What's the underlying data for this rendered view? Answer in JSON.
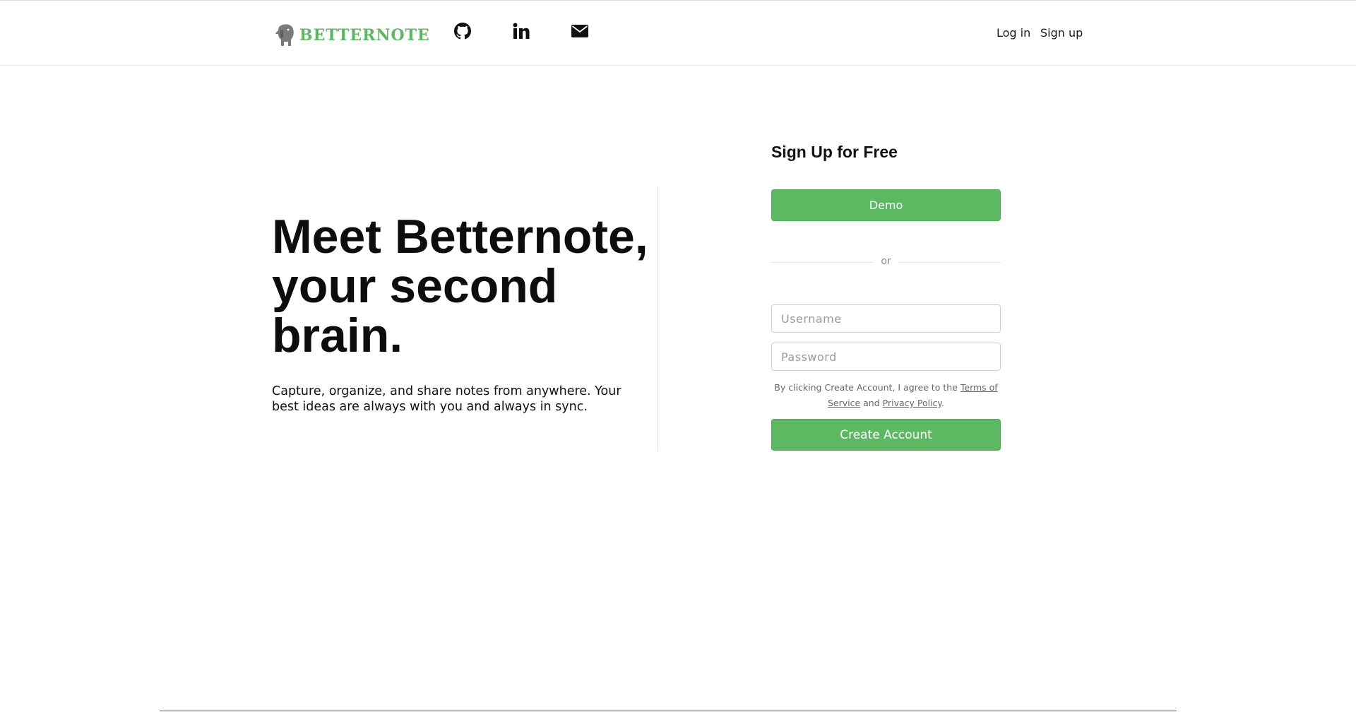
{
  "header": {
    "brand": "BETTERNOTE",
    "brand_color": "#5db862",
    "icons": [
      "elephant-logo",
      "github-icon",
      "linkedin-icon",
      "envelope-icon"
    ],
    "login_label": "Log in",
    "signup_label": "Sign up"
  },
  "hero": {
    "title_line1": "Meet Betternote,",
    "title_line2": "your second",
    "title_line3": "brain.",
    "subtitle": "Capture, organize, and share notes from anywhere. Your best ideas are always with you and always in sync."
  },
  "signup_form": {
    "title": "Sign Up for Free",
    "demo_label": "Demo",
    "or_label": "or",
    "username_placeholder": "Username",
    "password_placeholder": "Password",
    "terms_prefix": "By clicking Create Account, I agree to the ",
    "terms_link": "Terms of Service",
    "terms_middle": " and ",
    "privacy_link": "Privacy Policy",
    "terms_suffix": ".",
    "create_label": "Create Account",
    "accent_color": "#5db862"
  }
}
